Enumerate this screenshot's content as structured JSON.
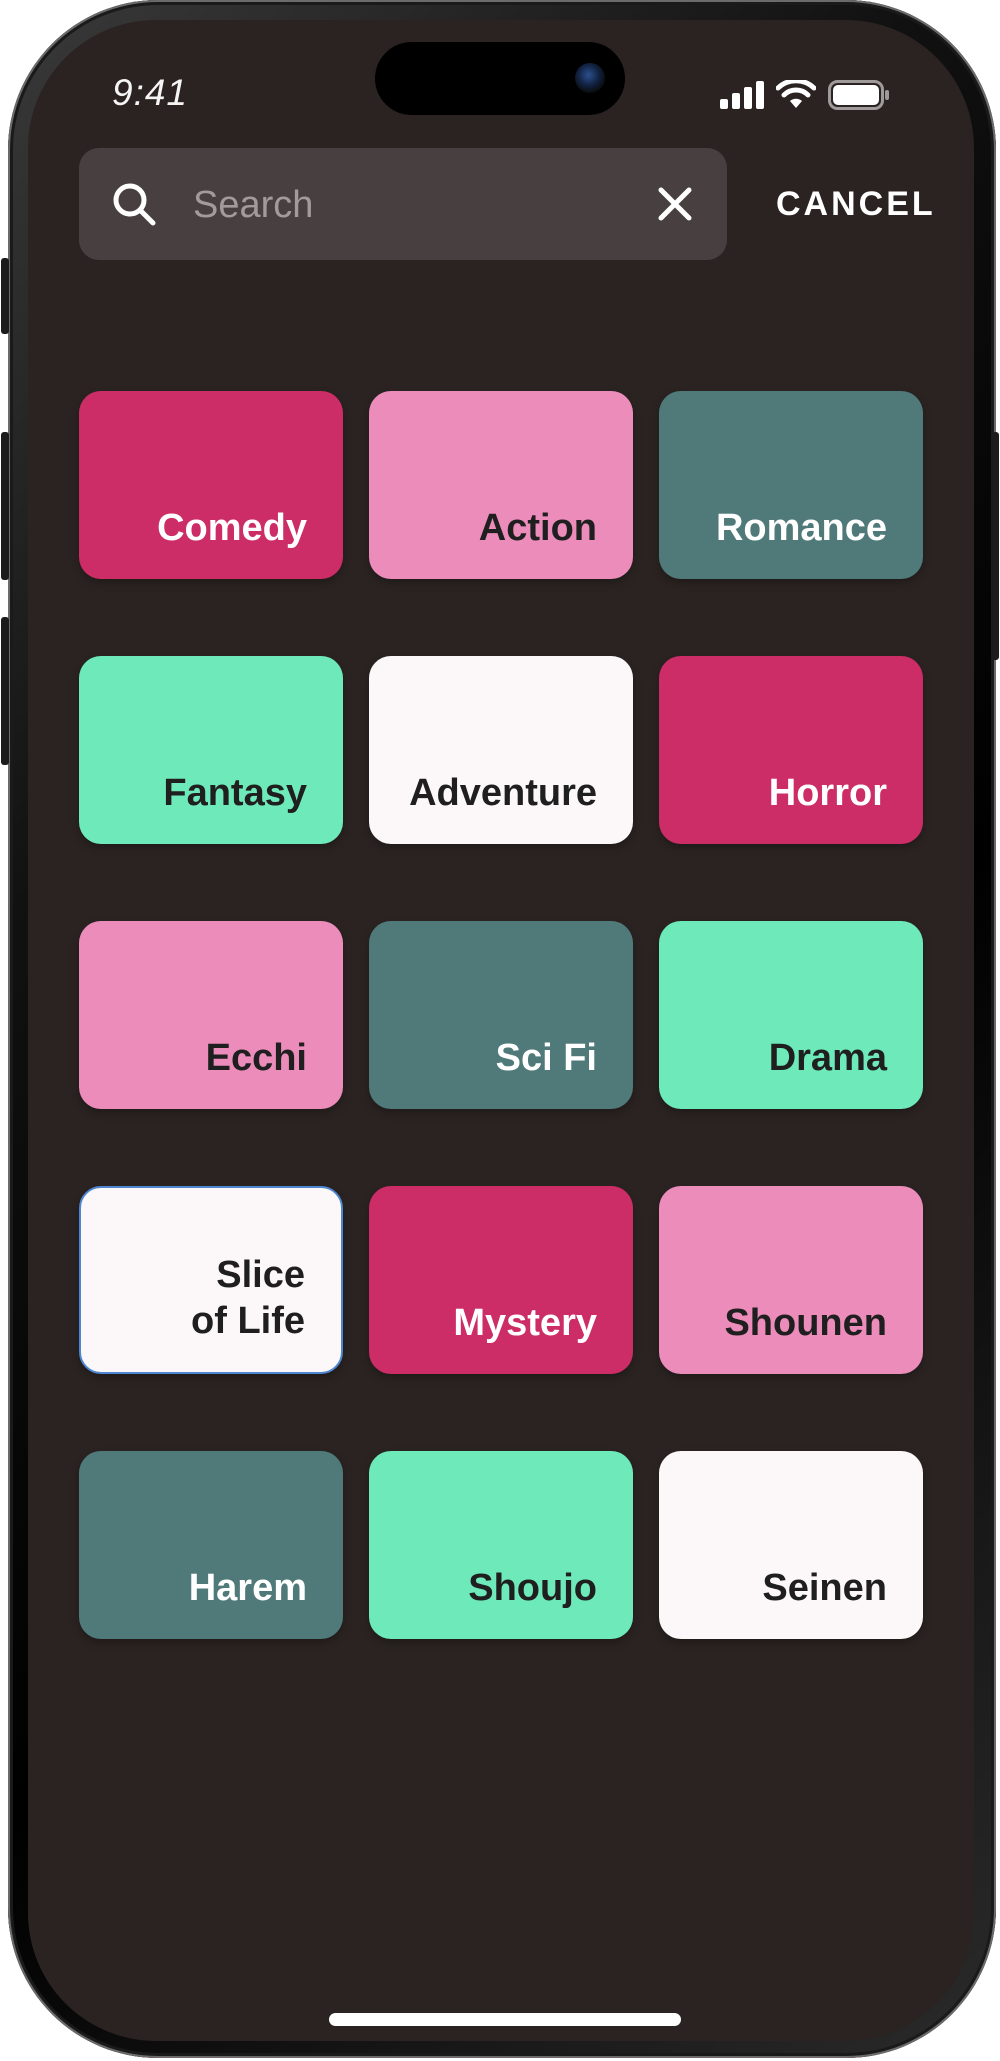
{
  "status_bar": {
    "time": "9:41"
  },
  "search": {
    "placeholder": "Search",
    "value": ""
  },
  "header": {
    "cancel_label": "CANCEL"
  },
  "colors": {
    "crimson": "#cc2d66",
    "pink": "#ec8cba",
    "teal": "#507a79",
    "mint": "#6ee9b9",
    "white": "#fcf7f9",
    "dark_text": "#1f1f1f",
    "light_text": "#ffffff",
    "background": "#2a2321",
    "search_bg": "#484040",
    "selected_border": "#4f86d1"
  },
  "genres": [
    {
      "label": "Comedy",
      "bg": "#cc2d66",
      "fg": "#ffffff",
      "selected": false
    },
    {
      "label": "Action",
      "bg": "#ec8cba",
      "fg": "#1f1f1f",
      "selected": false
    },
    {
      "label": "Romance",
      "bg": "#507a79",
      "fg": "#ffffff",
      "selected": false
    },
    {
      "label": "Fantasy",
      "bg": "#6ee9b9",
      "fg": "#1f1f1f",
      "selected": false
    },
    {
      "label": "Adventure",
      "bg": "#fcf7f9",
      "fg": "#1f1f1f",
      "selected": false
    },
    {
      "label": "Horror",
      "bg": "#cc2d66",
      "fg": "#ffffff",
      "selected": false
    },
    {
      "label": "Ecchi",
      "bg": "#ec8cba",
      "fg": "#1f1f1f",
      "selected": false
    },
    {
      "label": "Sci Fi",
      "bg": "#507a79",
      "fg": "#ffffff",
      "selected": false
    },
    {
      "label": "Drama",
      "bg": "#6ee9b9",
      "fg": "#1f1f1f",
      "selected": false
    },
    {
      "label": "Slice\nof Life",
      "bg": "#fcf7f9",
      "fg": "#1f1f1f",
      "selected": true
    },
    {
      "label": "Mystery",
      "bg": "#cc2d66",
      "fg": "#ffffff",
      "selected": false
    },
    {
      "label": "Shounen",
      "bg": "#ec8cba",
      "fg": "#1f1f1f",
      "selected": false
    },
    {
      "label": "Harem",
      "bg": "#507a79",
      "fg": "#ffffff",
      "selected": false
    },
    {
      "label": "Shoujo",
      "bg": "#6ee9b9",
      "fg": "#1f1f1f",
      "selected": false
    },
    {
      "label": "Seinen",
      "bg": "#fcf7f9",
      "fg": "#1f1f1f",
      "selected": false
    }
  ]
}
